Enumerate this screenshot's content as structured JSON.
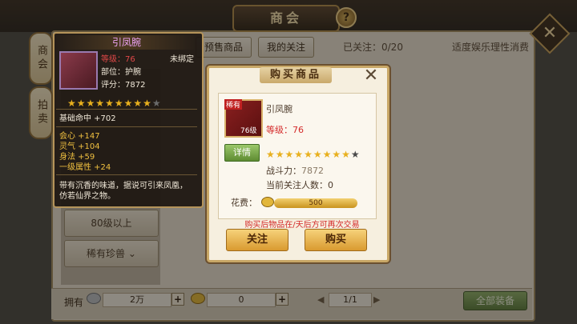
{
  "header": {
    "title": "商会",
    "help": "?",
    "close": "✕"
  },
  "side_tabs": [
    "商会",
    "拍卖"
  ],
  "tabs": {
    "presale": "预售商品",
    "my_watch": "我的关注",
    "watch_count": "已关注：0/20",
    "notice": "适度娱乐理性消费"
  },
  "left_list": {
    "level_item": "80级以上",
    "rare_beast": "稀有珍兽"
  },
  "bottom": {
    "owned_label": "拥有",
    "silver_value": "2万",
    "gold_value": "0",
    "page": "1/1",
    "all_equipment": "全部装备"
  },
  "tooltip": {
    "name": "引凤腕",
    "level_label": "等级：",
    "level_value": "76",
    "bind_status": "未绑定",
    "slot": "部位：护腕",
    "score": "评分：7872",
    "stars_filled": 9,
    "stars_total": 10,
    "base_stat": "基础命中 +702",
    "stats": [
      "会心 +147",
      "灵气 +104",
      "身法 +59",
      "一级属性 +24"
    ],
    "description_line1": "带有沉香的味道，据说可引来凤凰，",
    "description_line2": "仿若仙界之物。"
  },
  "dialog": {
    "title": "购买商品",
    "close_icon": "✕",
    "rarity": "稀有",
    "item_level": "76级",
    "item_name": "引凤腕",
    "level_label": "等级：",
    "level_value": "76",
    "detail_button": "详情",
    "stars_filled": 9,
    "stars_total": 10,
    "power_label": "战斗力：",
    "power_value": "7872",
    "watchers_label": "当前关注人数：",
    "watchers_value": "0",
    "cost_label": "花费：",
    "cost_value": "500",
    "trade_notice": "购买后物品在/天后方可再次交易",
    "follow_button": "关注",
    "buy_button": "购买"
  },
  "colors": {
    "gold_accent": "#c8a766",
    "rare_red": "#d42b2b",
    "star_gold": "#e8b01e",
    "tooltip_name": "#e9a0f0"
  }
}
